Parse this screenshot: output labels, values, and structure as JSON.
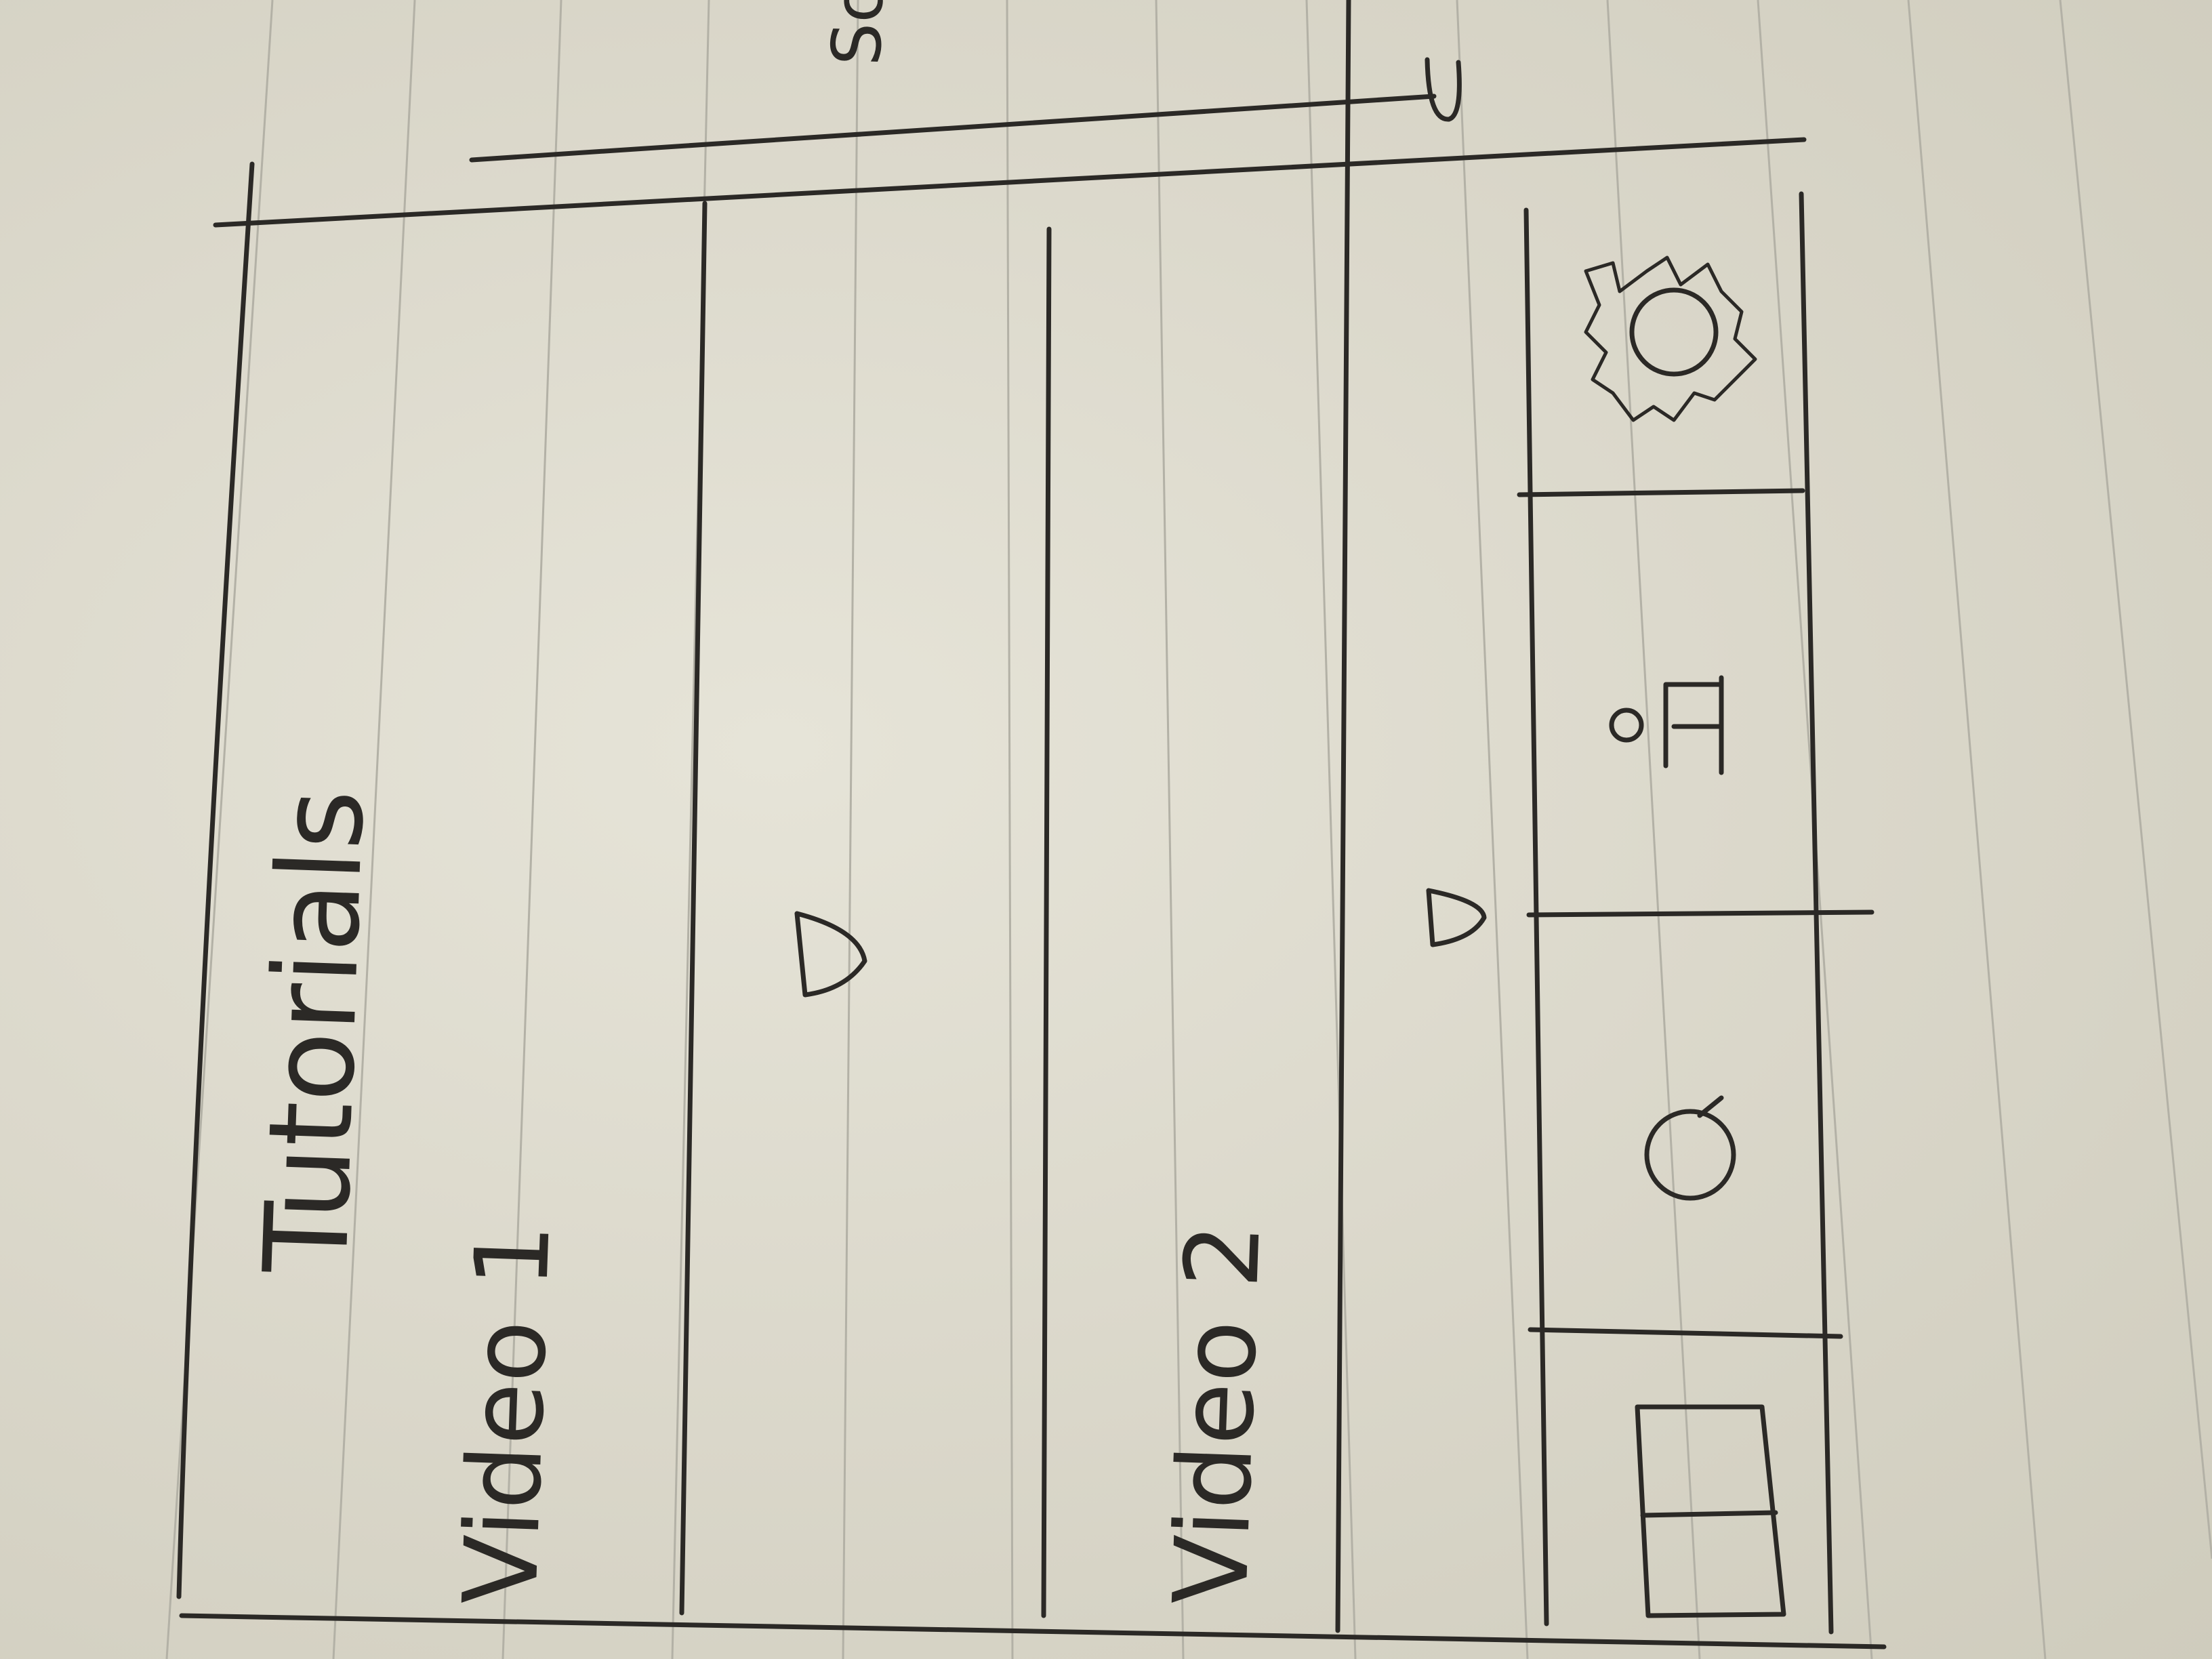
{
  "app": {
    "title": "Tutorials"
  },
  "videos": [
    {
      "label": "Video 1"
    },
    {
      "label": "Video 2"
    }
  ],
  "scroll_hint": "Sc",
  "footer_nav": {
    "items": [
      {
        "icon": "grid-icon"
      },
      {
        "icon": "search-icon"
      },
      {
        "icon": "profile-icon"
      },
      {
        "icon": "gear-icon"
      }
    ]
  },
  "colors": {
    "paper": "#e2e0d4",
    "ink": "#2b2926",
    "ruled_line": "#b3b1a6"
  }
}
